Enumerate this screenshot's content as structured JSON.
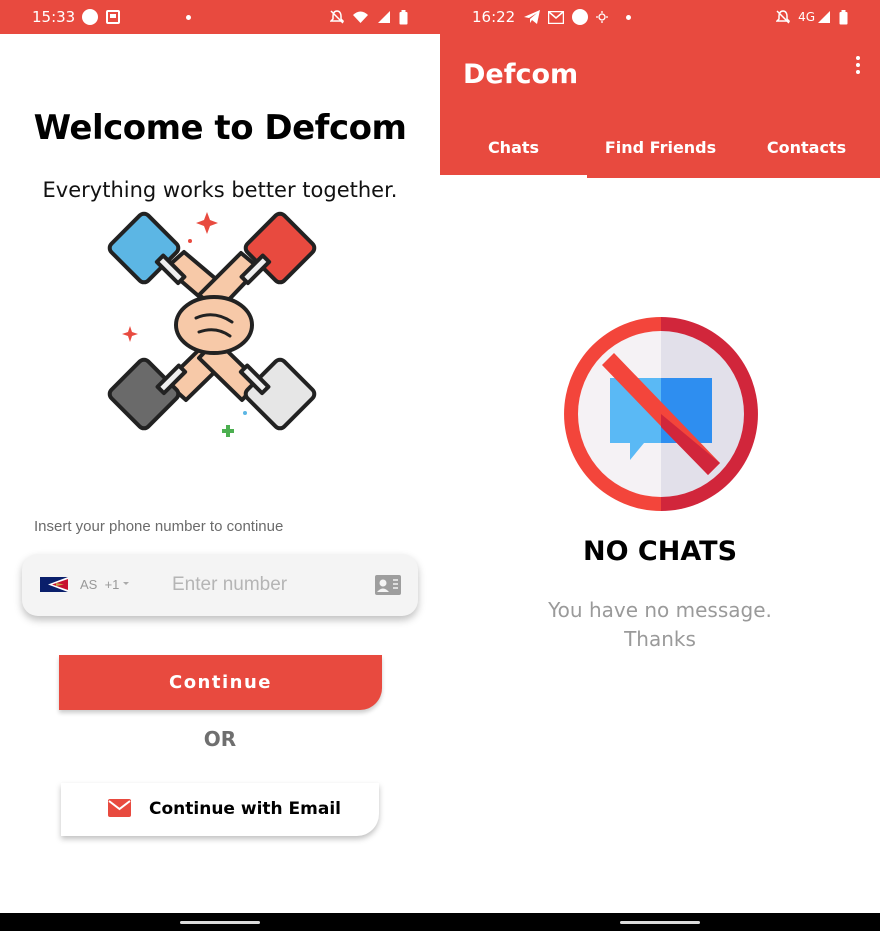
{
  "left": {
    "statusbar": {
      "time": "15:33"
    },
    "welcome": {
      "title": "Welcome to Defcom",
      "subtitle": "Everything works better together."
    },
    "phone": {
      "hint": "Insert your phone number to continue",
      "country_code": "AS",
      "dial_code": "+1",
      "placeholder": "Enter number",
      "value": ""
    },
    "continue_label": "Continue",
    "or_label": "OR",
    "email_label": "Continue with Email"
  },
  "right": {
    "statusbar": {
      "time": "16:22",
      "network": "4G"
    },
    "app_title": "Defcom",
    "tabs": [
      {
        "label": "Chats",
        "active": true
      },
      {
        "label": "Find Friends",
        "active": false
      },
      {
        "label": "Contacts",
        "active": false
      }
    ],
    "empty_state": {
      "title": "NO CHATS",
      "message": "You have no message.\nThanks"
    }
  },
  "colors": {
    "accent": "#e84a3f",
    "tab_text": "#ffffff",
    "muted_text": "#9a9a9a"
  },
  "icons": [
    "notifications-off-icon",
    "wifi-icon",
    "signal-icon",
    "battery-icon",
    "telegram-icon",
    "gmail-icon",
    "circle-icon",
    "location-icon",
    "more-vert-icon",
    "contact-card-icon",
    "mail-icon",
    "no-chat-icon",
    "teamwork-hands-illustration"
  ]
}
